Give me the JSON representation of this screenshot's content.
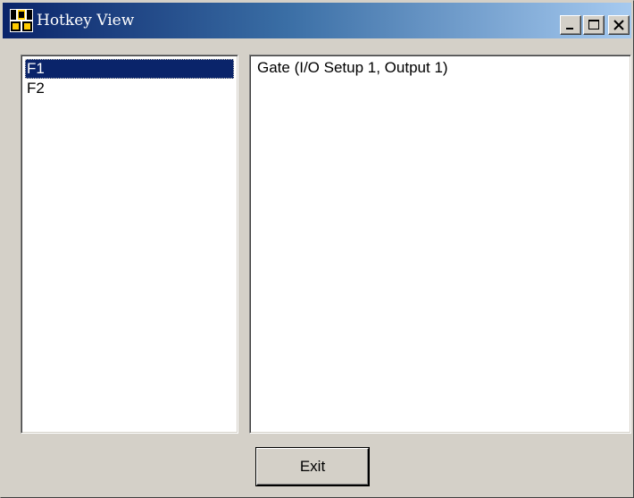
{
  "window": {
    "title": "Hotkey View"
  },
  "titlebar": {
    "icons": [
      "app-icon",
      "minimize-icon",
      "maximize-icon",
      "close-icon"
    ]
  },
  "hotkeys": {
    "items": [
      "F1",
      "F2"
    ],
    "selected": "F1"
  },
  "detail": {
    "text": "Gate (I/O Setup 1, Output 1)"
  },
  "actions": {
    "exit_label": "Exit"
  },
  "colors": {
    "titlebar_start": "#0a246a",
    "titlebar_end": "#a6caf0",
    "selection": "#0a246a",
    "face": "#d4d0c8"
  }
}
